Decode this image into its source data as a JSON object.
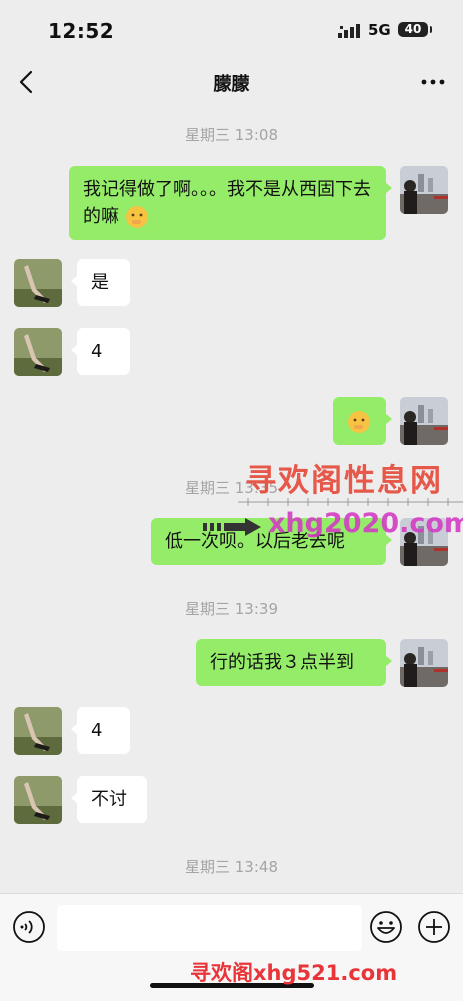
{
  "status_bar": {
    "time": "12:52",
    "network": "5G",
    "battery": "40"
  },
  "header": {
    "title": "朦朦"
  },
  "messages": {
    "ts1": "星期三 13:08",
    "m1": "我记得做了啊。。。我不是从西固下去的嘛",
    "m2": "是",
    "m3": "4",
    "ts2": "星期三 13:35",
    "m5": "低一次呗。以后老去呢",
    "ts3": "星期三 13:39",
    "m6": "行的话我３点半到",
    "m7": "4",
    "m8": "不讨",
    "ts4": "星期三 13:48"
  },
  "watermarks": {
    "w1": "寻欢阁性息网",
    "w2": "xhg2020.com",
    "w3": "寻欢阁xhg521.com"
  },
  "icons": [
    "back-arrow-icon",
    "more-dots-icon",
    "voice-icon",
    "emoji-icon",
    "plus-icon",
    "shush-emoji-icon"
  ],
  "colors": {
    "outgoing_bubble": "#95ec69",
    "incoming_bubble": "#ffffff",
    "background": "#ededed"
  }
}
